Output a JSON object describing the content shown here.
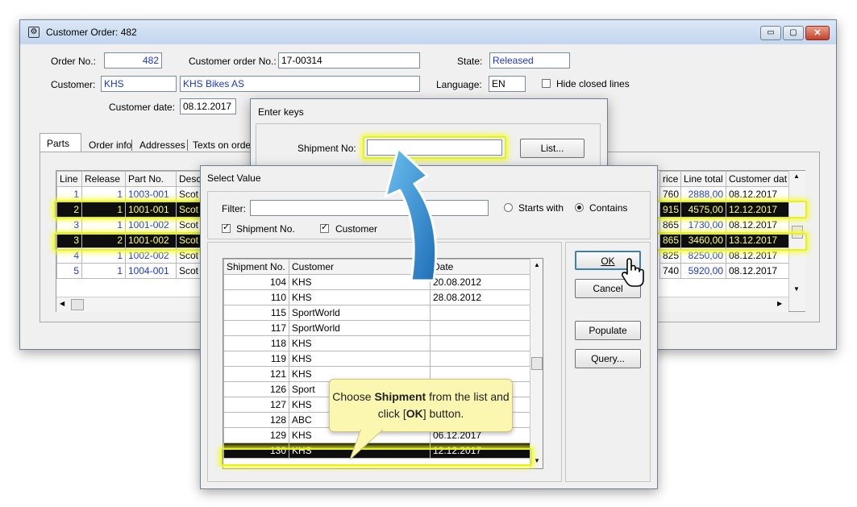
{
  "main_window": {
    "title": "Customer Order: 482",
    "order_no_label": "Order No.:",
    "order_no": "482",
    "customer_order_no_label": "Customer order No.:",
    "customer_order_no": "17-00314",
    "state_label": "State:",
    "state": "Released",
    "customer_label": "Customer:",
    "customer_code": "KHS",
    "customer_name": "KHS Bikes AS",
    "language_label": "Language:",
    "language": "EN",
    "hide_closed_label": "Hide closed lines",
    "customer_date_label": "Customer date:",
    "customer_date": "08.12.2017",
    "tabs": [
      "Parts",
      "Order info",
      "Addresses",
      "Texts on orde"
    ],
    "left_columns": [
      "Line",
      "Release",
      "Part No.",
      "Desc"
    ],
    "right_columns": [
      "rice",
      "Line total",
      "Customer dat"
    ],
    "rows": [
      {
        "line": "1",
        "release": "1",
        "part": "1003-001",
        "desc": "Scot",
        "price": "760",
        "total": "2888,00",
        "date": "08.12.2017",
        "highlight": false
      },
      {
        "line": "2",
        "release": "1",
        "part": "1001-001",
        "desc": "Scot",
        "price": "915",
        "total": "4575,00",
        "date": "12.12.2017",
        "highlight": true
      },
      {
        "line": "3",
        "release": "1",
        "part": "1001-002",
        "desc": "Scot",
        "price": "865",
        "total": "1730,00",
        "date": "08.12.2017",
        "highlight": false
      },
      {
        "line": "3",
        "release": "2",
        "part": "1001-002",
        "desc": "Scot",
        "price": "865",
        "total": "3460,00",
        "date": "13.12.2017",
        "highlight": true
      },
      {
        "line": "4",
        "release": "1",
        "part": "1002-002",
        "desc": "Scot",
        "price": "825",
        "total": "8250,00",
        "date": "08.12.2017",
        "highlight": false
      },
      {
        "line": "5",
        "release": "1",
        "part": "1004-001",
        "desc": "Scot",
        "price": "740",
        "total": "5920,00",
        "date": "08.12.2017",
        "highlight": false
      }
    ]
  },
  "enter_keys": {
    "title": "Enter keys",
    "shipment_label": "Shipment No:",
    "shipment_value": "",
    "list_button": "List..."
  },
  "select_value": {
    "title": "Select Value",
    "filter_label": "Filter:",
    "filter_value": "",
    "starts_with_label": "Starts with",
    "contains_label": "Contains",
    "shipment_check_label": "Shipment No.",
    "customer_check_label": "Customer",
    "columns": [
      "Shipment No.",
      "Customer",
      "Date"
    ],
    "rows": [
      {
        "no": "104",
        "customer": "KHS",
        "date": "20.08.2012",
        "highlight": false
      },
      {
        "no": "110",
        "customer": "KHS",
        "date": "28.08.2012",
        "highlight": false
      },
      {
        "no": "115",
        "customer": "SportWorld",
        "date": "",
        "highlight": false
      },
      {
        "no": "117",
        "customer": "SportWorld",
        "date": "",
        "highlight": false
      },
      {
        "no": "118",
        "customer": "KHS",
        "date": "",
        "highlight": false
      },
      {
        "no": "119",
        "customer": "KHS",
        "date": "",
        "highlight": false
      },
      {
        "no": "121",
        "customer": "KHS",
        "date": "",
        "highlight": false
      },
      {
        "no": "126",
        "customer": "Sport",
        "date": "",
        "highlight": false
      },
      {
        "no": "127",
        "customer": "KHS",
        "date": "",
        "highlight": false
      },
      {
        "no": "128",
        "customer": "ABC",
        "date": "",
        "highlight": false
      },
      {
        "no": "129",
        "customer": "KHS",
        "date": "06.12.2017",
        "highlight": false
      },
      {
        "no": "130",
        "customer": "KHS",
        "date": "12.12.2017",
        "highlight": true
      }
    ],
    "ok_button": "OK",
    "cancel_button": "Cancel",
    "populate_button": "Populate",
    "query_button": "Query..."
  },
  "callout": {
    "part1": "Choose ",
    "bold1": "Shipment",
    "part2": " from the list and click [",
    "bold2": "OK",
    "part3": "] button."
  },
  "colors": {
    "highlight_bg": "#0e0e0e",
    "highlight_fg": "#ffff7a",
    "glow": "#e8f21a",
    "arrow": "#3a9ad9",
    "link": "#1a36d6",
    "callout_bg": "#fbf6b0"
  }
}
